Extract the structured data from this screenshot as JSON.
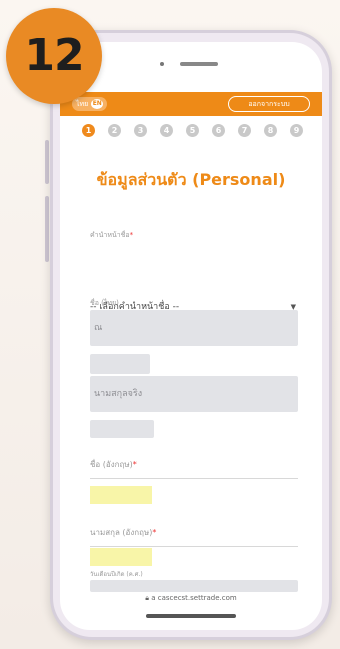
{
  "badge": {
    "number": "12"
  },
  "topbar": {
    "lang_label": "ไทย",
    "lang_icon": "EN",
    "top_button": "ออกจากระบบ"
  },
  "steps": [
    "1",
    "2",
    "3",
    "4",
    "5",
    "6",
    "7",
    "8",
    "9"
  ],
  "active_step": 1,
  "form": {
    "title": "ข้อมูลส่วนตัว (Personal)",
    "prefix_label": "คำนำหน้าชื่อ",
    "prefix_value": "-- เลือกคำนำหน้าชื่อ --",
    "firstname_th_label": "ชื่อ (ไทย)",
    "firstname_th_value": "ณ",
    "lastname_th_value": "นามสกุลจริง",
    "firstname_en_label": "ชื่อ (อังกฤษ)",
    "lastname_en_label": "นามสกุล (อังกฤษ)",
    "birthdate_label": "วันเดือนปีเกิด (ค.ศ.)",
    "required_mark": "*"
  },
  "browser": {
    "url": "a cascecst.settrade.com"
  },
  "colors": {
    "accent": "#ee8a17",
    "badge": "#e98a24",
    "highlight": "#f8f5a8",
    "field_bg": "#e2e3e7"
  }
}
